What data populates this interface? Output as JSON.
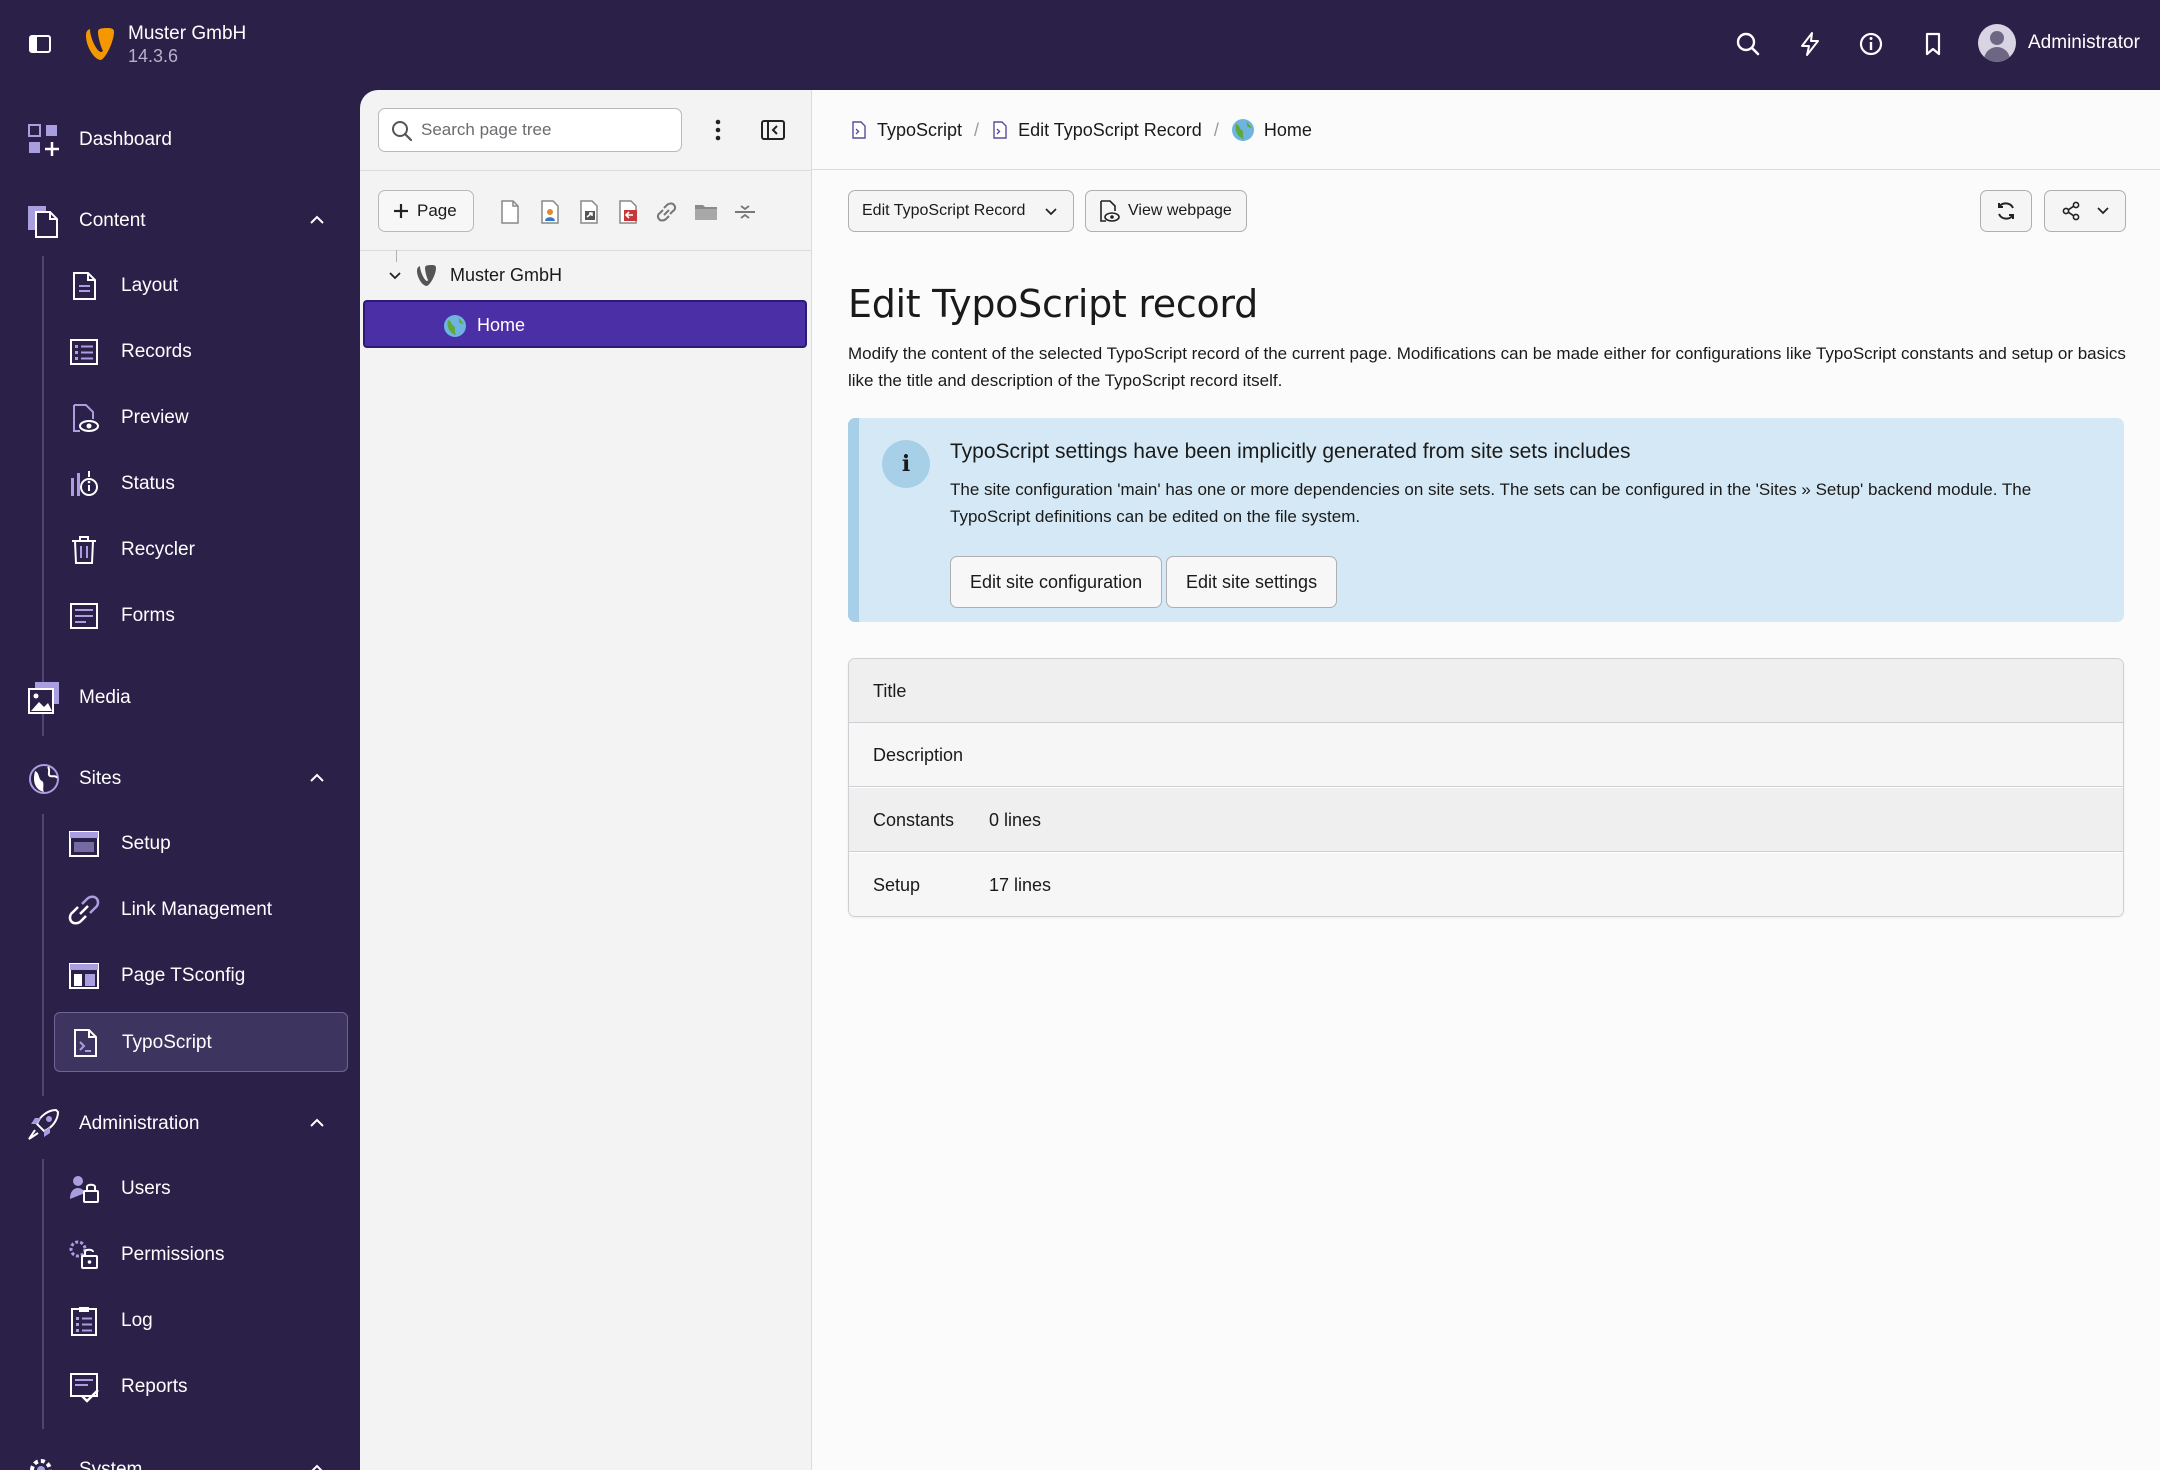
{
  "topbar": {
    "site_name": "Muster GmbH",
    "version": "14.3.6",
    "user_name": "Administrator",
    "icons": [
      "sidebar-toggle-icon",
      "typo3-logo-icon",
      "search-icon",
      "flash-icon",
      "info-icon",
      "bookmark-icon",
      "avatar"
    ]
  },
  "menu": {
    "dashboard": "Dashboard",
    "content": {
      "label": "Content",
      "items": [
        "Layout",
        "Records",
        "Preview",
        "Status",
        "Recycler",
        "Forms"
      ]
    },
    "media": "Media",
    "sites": {
      "label": "Sites",
      "items": [
        "Setup",
        "Link Management",
        "Page TSconfig",
        "TypoScript"
      ],
      "active": "TypoScript"
    },
    "administration": {
      "label": "Administration",
      "items": [
        "Users",
        "Permissions",
        "Log",
        "Reports"
      ]
    },
    "system": "System"
  },
  "tree": {
    "search_placeholder": "Search page tree",
    "new_page_label": "Page",
    "root": "Muster GmbH",
    "selected": "Home"
  },
  "breadcrumb": [
    "TypoScript",
    "Edit TypoScript Record",
    "Home"
  ],
  "toolbar": {
    "select_label": "Edit TypoScript Record",
    "view_label": "View webpage"
  },
  "main": {
    "title": "Edit TypoScript record",
    "intro": "Modify the content of the selected TypoScript record of the current page. Modifications can be made either for configurations like TypoScript constants and setup or basics like the title and description of the TypoScript record itself.",
    "callout": {
      "title": "TypoScript settings have been implicitly generated from site sets includes",
      "text": "The site configuration 'main' has one or more dependencies on site sets. The sets can be configured in the 'Sites » Setup' backend module. The TypoScript definitions can be edited on the file system.",
      "btn_site_config": "Edit site configuration",
      "btn_site_settings": "Edit site settings"
    },
    "rows": [
      {
        "key": "Title",
        "value": ""
      },
      {
        "key": "Description",
        "value": ""
      },
      {
        "key": "Constants",
        "value": "0 lines"
      },
      {
        "key": "Setup",
        "value": "17 lines"
      }
    ]
  },
  "colors": {
    "chrome": "#2a2048",
    "tree_selected": "#4a2fa6",
    "callout_bg": "#d4e9f5",
    "callout_accent": "#a7d0e8",
    "typo3_orange": "#f49700"
  }
}
